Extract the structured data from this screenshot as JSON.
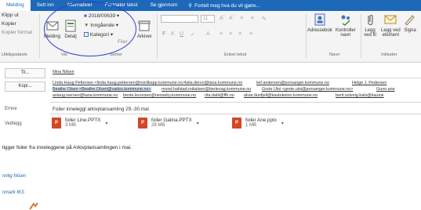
{
  "tabs": [
    "Melding",
    "Sett inn",
    "Alternativer",
    "Formater tekst",
    "Se gjennom"
  ],
  "tell_me": "Fortell meg hva du vil gjøre...",
  "clipboard": {
    "paste_label": "Klipp ut",
    "copy_label": "Kopier",
    "format_label": "Kopier format",
    "group_label": "Utklippstavle"
  },
  "vis": {
    "melding_label": "Melding",
    "detalj_label": "Detalj",
    "group_label": "Vis"
  },
  "sorter": {
    "folder_value": "2018/00639",
    "incoming_label": "Inngående",
    "category_label": "Kategori",
    "group_label": "Sorter",
    "filer_label": "Filer",
    "arkiver_label": "Arkiver"
  },
  "basic_text": {
    "font_size": "11",
    "group_label": "Enkel tekst"
  },
  "names": {
    "address_book": "Adressebok",
    "check_names_line1": "Kontroller",
    "check_names_line2": "navn",
    "group_label": "Navn"
  },
  "include": {
    "attach_file_line1": "Legg",
    "attach_file_line2": "ved fil",
    "attach_item_line1": "Legg ved",
    "attach_item_line2": "element",
    "signature_label": "Signa",
    "group_label": "Inkluder"
  },
  "fields": {
    "to_button": "Til...",
    "to_value": "Nina Nilsen",
    "cc_button": "Kopi...",
    "subject_label": "Emne",
    "subject_value": "Foiler inneleggl arkivplansamling 29.-30.mai",
    "attach_label": "Vedlegg"
  },
  "recipients": {
    "row1": [
      "Linda Haug Pettersen <linda.haug.pettersen@nordkapp.kommune.no>",
      "laila.dervo@tana.kommune.no",
      "leif.andersen@porsanger.kommune.no",
      "Helge J. Pedersen"
    ],
    "row2": [
      "Beathe Olsen <Beathe.Olsen@vadso.kommune.no>",
      "mond.hafstad.mikalsen@berlevag.kommune.no",
      "Grete Utsi <grete.utsi@porsanger.kommune.no>",
      "Gunn.ane"
    ],
    "row3": [
      "aslaug.iversen@tana.kommune.no",
      "bente.levorsen@nesseby.kommune.no",
      "rita.dahl@ffk.no",
      "alvar.dunfjell@kautokeino.kommune.no",
      "berit.solveig.bals@kautok"
    ]
  },
  "attachments": [
    {
      "name": "foiler Line.PPTX",
      "size": "3 MB"
    },
    {
      "name": "foiler Galina.PPTX",
      "size": "28 MB"
    },
    {
      "name": "foiler Ane.pptx",
      "size": "1 MB"
    }
  ],
  "body": {
    "line1": "ligger foiler fra inneleggene på Arkivplansamlingen i mai.",
    "greeting": "nnlig hilsen",
    "org": "nmark IKS"
  },
  "colors": {
    "accent": "#1d68b8",
    "annotation_circle": "#2b3fd1",
    "ppt_orange": "#d24726"
  }
}
